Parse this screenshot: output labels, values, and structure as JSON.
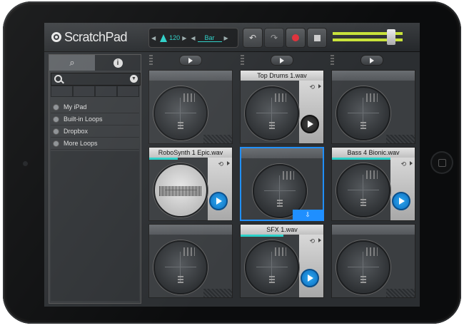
{
  "app": {
    "logo_text": "ScratchPad"
  },
  "transport": {
    "tempo": "120",
    "grid_label": "Bar"
  },
  "sidebar": {
    "search_placeholder": "",
    "items": [
      {
        "label": "My iPad"
      },
      {
        "label": "Built-in Loops"
      },
      {
        "label": "Dropbox"
      },
      {
        "label": "More Loops"
      }
    ]
  },
  "grid": {
    "cells": [
      {
        "title": ""
      },
      {
        "title": "Top Drums 1.wav"
      },
      {
        "title": ""
      },
      {
        "title": "RoboSynth 1 Epic.wav"
      },
      {
        "title": ""
      },
      {
        "title": "Bass 4 Bionic.wav"
      },
      {
        "title": ""
      },
      {
        "title": "SFX 1.wav"
      },
      {
        "title": ""
      }
    ]
  },
  "colors": {
    "accent": "#2ad0c8",
    "active_play": "#1f8fff",
    "record": "#e0303a",
    "level": "#c8e23a"
  }
}
